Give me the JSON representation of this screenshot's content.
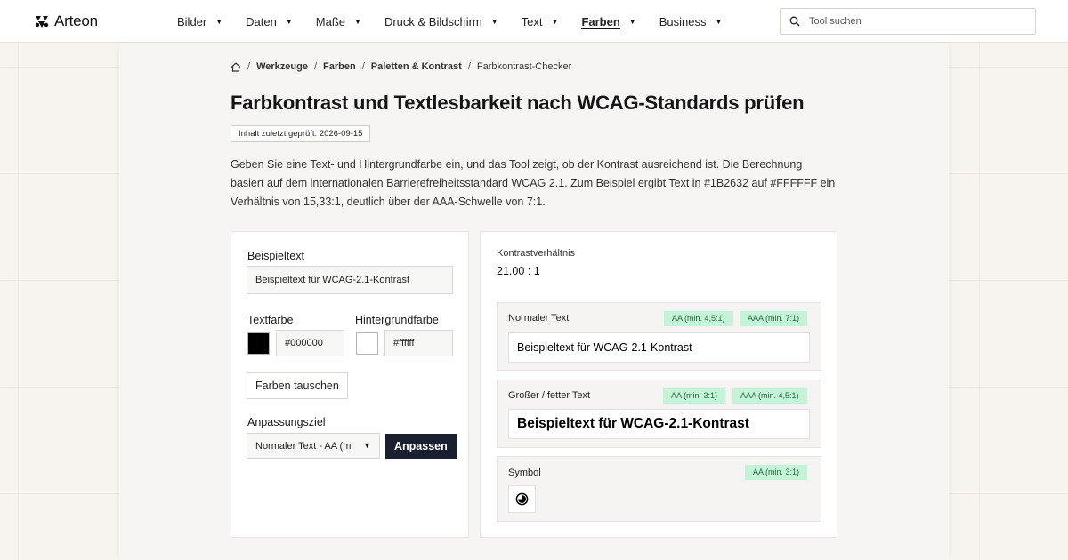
{
  "brand": {
    "name": "Arteon"
  },
  "nav": {
    "items": [
      {
        "label": "Bilder"
      },
      {
        "label": "Daten"
      },
      {
        "label": "Maße"
      },
      {
        "label": "Druck & Bildschirm"
      },
      {
        "label": "Text"
      },
      {
        "label": "Farben",
        "active": true
      },
      {
        "label": "Business"
      }
    ],
    "caret_glyph": "▼"
  },
  "search": {
    "placeholder": "Tool suchen",
    "value": ""
  },
  "breadcrumb": {
    "items": [
      "Werkzeuge",
      "Farben",
      "Paletten & Kontrast"
    ],
    "current": "Farbkontrast-Checker",
    "separator": "/"
  },
  "page": {
    "title": "Farbkontrast und Textlesbarkeit nach WCAG-Standards prüfen",
    "updated": "Inhalt zuletzt geprüft: 2026-09-15",
    "intro": "Geben Sie eine Text- und Hintergrundfarbe ein, und das Tool zeigt, ob der Kontrast ausreichend ist. Die Berechnung basiert auf dem internationalen Barrierefreiheitsstandard WCAG 2.1. Zum Beispiel ergibt Text in #1B2632 auf #FFFFFF ein Verhältnis von 15,33:1, deutlich über der AAA-Schwelle von 7:1."
  },
  "form": {
    "sample_label": "Beispieltext",
    "sample_value": "Beispieltext für WCAG-2.1-Kontrast",
    "text_color_label": "Textfarbe",
    "text_color_value": "#000000",
    "text_color_swatch": "#000000",
    "bg_color_label": "Hintergrundfarbe",
    "bg_color_value": "#ffffff",
    "bg_color_swatch": "#ffffff",
    "swap_button": "Farben tauschen",
    "target_label": "Anpassungsziel",
    "target_value": "Normaler Text - AA (m",
    "adjust_button": "Anpassen"
  },
  "results": {
    "ratio_label": "Kontrastverhältnis",
    "ratio_value": "21.00 : 1",
    "normal": {
      "title": "Normaler Text",
      "badges": [
        "AA (min. 4,5:1)",
        "AAA (min. 7:1)"
      ],
      "preview": "Beispieltext für WCAG-2.1-Kontrast"
    },
    "large": {
      "title": "Großer / fetter Text",
      "badges": [
        "AA (min. 3:1)",
        "AAA (min. 4,5:1)"
      ],
      "preview": "Beispieltext für WCAG-2.1-Kontrast"
    },
    "symbol": {
      "title": "Symbol",
      "badges": [
        "AA (min. 3:1)"
      ],
      "icon": "contrast-icon"
    }
  },
  "colors": {
    "badge_bg": "#c6f2d8",
    "badge_text": "#1d6a3f",
    "primary_button": "#1b2030",
    "page_bg": "#f7f3ee"
  }
}
